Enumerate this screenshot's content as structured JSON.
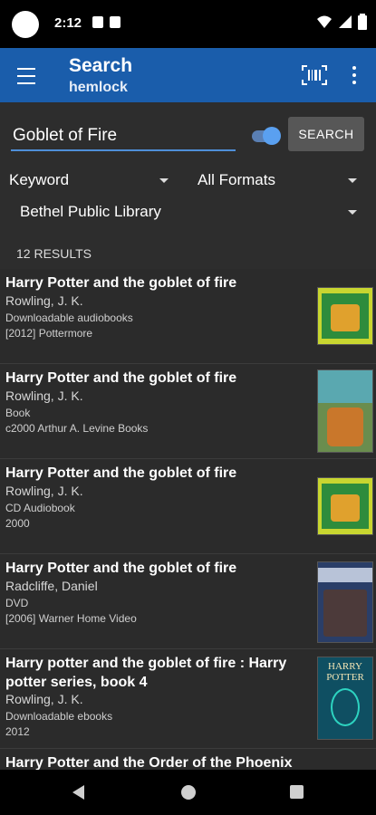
{
  "status_bar": {
    "time": "2:12"
  },
  "app_bar": {
    "title": "Search",
    "subtitle": "hemlock",
    "icons": [
      "menu-icon",
      "barcode-scan-icon",
      "overflow-menu-icon"
    ]
  },
  "search": {
    "query": "Goblet of Fire",
    "toggle_on": true,
    "button_label": "SEARCH",
    "class_dropdown": "Keyword",
    "format_dropdown": "All Formats",
    "library_dropdown": "Bethel Public Library"
  },
  "results": {
    "count_label": "12 RESULTS",
    "items": [
      {
        "title": "Harry Potter and the goblet of fire",
        "author": "Rowling, J. K.",
        "format": "Downloadable audiobooks",
        "pub": "[2012] Pottermore"
      },
      {
        "title": "Harry Potter and the goblet of fire",
        "author": "Rowling, J. K.",
        "format": "Book",
        "pub": "c2000 Arthur A. Levine Books"
      },
      {
        "title": "Harry Potter and the goblet of fire",
        "author": "Rowling, J. K.",
        "format": "CD Audiobook",
        "pub": "2000"
      },
      {
        "title": "Harry Potter and the goblet of fire",
        "author": "Radcliffe, Daniel",
        "format": "DVD",
        "pub": "[2006] Warner Home Video"
      },
      {
        "title": "Harry potter and the goblet of fire : Harry potter series, book 4",
        "author": "Rowling, J. K.",
        "format": "Downloadable ebooks",
        "pub": "2012"
      },
      {
        "title": "Harry Potter and the Order of the Phoenix",
        "author": "",
        "format": "",
        "pub": ""
      }
    ],
    "cover_last_text": "HARRY POTTER"
  },
  "nav_bar": {
    "icons": [
      "back-icon",
      "home-icon",
      "recents-icon"
    ]
  }
}
